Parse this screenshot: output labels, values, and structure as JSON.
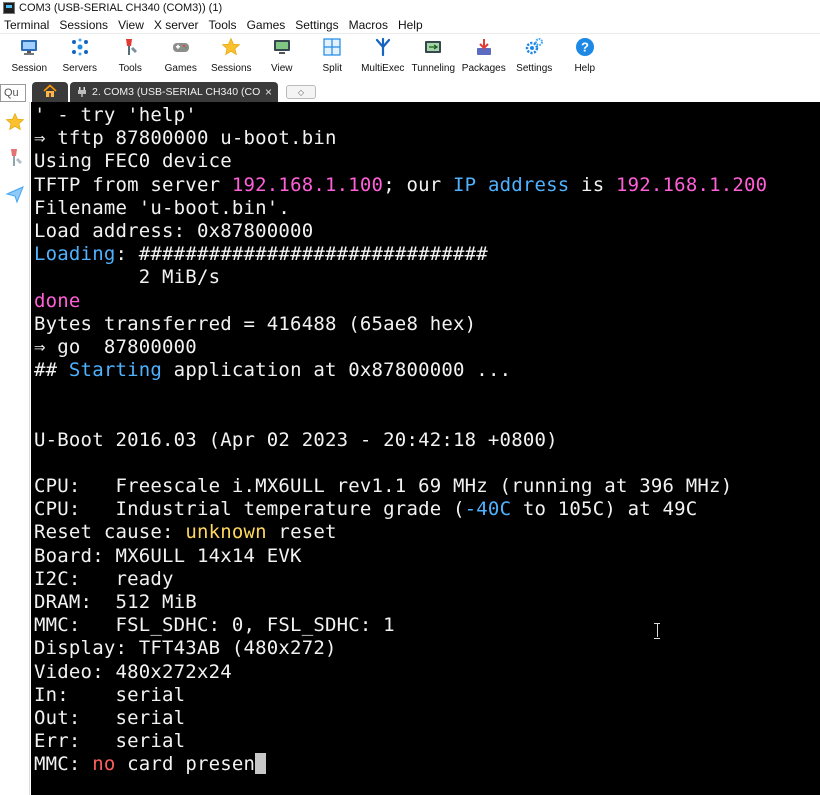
{
  "window": {
    "title": "COM3  (USB-SERIAL CH340 (COM3)) (1)"
  },
  "menu": [
    "Terminal",
    "Sessions",
    "View",
    "X server",
    "Tools",
    "Games",
    "Settings",
    "Macros",
    "Help"
  ],
  "toolbar": [
    {
      "label": "Session",
      "icon": "monitor-session-icon"
    },
    {
      "label": "Servers",
      "icon": "servers-network-icon"
    },
    {
      "label": "Tools",
      "icon": "tools-icon"
    },
    {
      "label": "Games",
      "icon": "gamepad-icon"
    },
    {
      "label": "Sessions",
      "icon": "star-icon"
    },
    {
      "label": "View",
      "icon": "view-monitor-icon"
    },
    {
      "label": "Split",
      "icon": "split-icon"
    },
    {
      "label": "MultiExec",
      "icon": "multiexec-fork-icon"
    },
    {
      "label": "Tunneling",
      "icon": "tunneling-icon"
    },
    {
      "label": "Packages",
      "icon": "packages-download-icon"
    },
    {
      "label": "Settings",
      "icon": "gears-icon"
    },
    {
      "label": "Help",
      "icon": "help-icon"
    }
  ],
  "quick_connect": {
    "value": "Qu"
  },
  "tabs": {
    "home_icon": "home-icon",
    "active": {
      "label": "2. COM3  (USB-SERIAL CH340 (CO",
      "close": "×",
      "icon": "serial-plug-icon"
    }
  },
  "sidebar": [
    {
      "icon": "star-icon"
    },
    {
      "icon": "tools-icon"
    },
    {
      "icon": "send-arrow-icon"
    }
  ],
  "colors": {
    "terminal_bg": "#000000",
    "text": "#f2f2f2",
    "magenta": "#ff5fd7",
    "blue": "#4fb2ff",
    "yellow": "#ffd75f",
    "red": "#ff5f5f"
  },
  "terminal": {
    "lines": [
      [
        {
          "t": "' - try 'help'",
          "c": "white"
        }
      ],
      [
        {
          "t": "⇒ tftp 87800000 u-boot.bin",
          "c": "white"
        }
      ],
      [
        {
          "t": "Using FEC0 device",
          "c": "white"
        }
      ],
      [
        {
          "t": "TFTP from server ",
          "c": "white"
        },
        {
          "t": "192.168.1.100",
          "c": "magenta"
        },
        {
          "t": "; our ",
          "c": "white"
        },
        {
          "t": "IP address",
          "c": "blue"
        },
        {
          "t": " is ",
          "c": "white"
        },
        {
          "t": "192.168.1.200",
          "c": "magenta"
        }
      ],
      [
        {
          "t": "Filename 'u-boot.bin'.",
          "c": "white"
        }
      ],
      [
        {
          "t": "Load address: 0x87800000",
          "c": "white"
        }
      ],
      [
        {
          "t": "Loading",
          "c": "blue"
        },
        {
          "t": ": ##############################",
          "c": "white"
        }
      ],
      [
        {
          "t": "         2 MiB/s",
          "c": "white"
        }
      ],
      [
        {
          "t": "done",
          "c": "magenta"
        }
      ],
      [
        {
          "t": "Bytes transferred = 416488 (65ae8 hex)",
          "c": "white"
        }
      ],
      [
        {
          "t": "⇒ go  87800000",
          "c": "white"
        }
      ],
      [
        {
          "t": "## ",
          "c": "white"
        },
        {
          "t": "Starting",
          "c": "blue"
        },
        {
          "t": " application at 0x87800000 ...",
          "c": "white"
        }
      ],
      [
        {
          "t": "",
          "c": "white"
        }
      ],
      [
        {
          "t": "",
          "c": "white"
        }
      ],
      [
        {
          "t": "U-Boot 2016.03 (Apr 02 2023 - 20:42:18 +0800)",
          "c": "white"
        }
      ],
      [
        {
          "t": "",
          "c": "white"
        }
      ],
      [
        {
          "t": "CPU:   Freescale i.MX6ULL rev1.1 69 MHz (running at 396 MHz)",
          "c": "white"
        }
      ],
      [
        {
          "t": "CPU:   Industrial temperature grade (",
          "c": "white"
        },
        {
          "t": "-40C",
          "c": "blue"
        },
        {
          "t": " to 105C) at 49C",
          "c": "white"
        }
      ],
      [
        {
          "t": "Reset cause: ",
          "c": "white"
        },
        {
          "t": "unknown",
          "c": "yellow"
        },
        {
          "t": " reset",
          "c": "white"
        }
      ],
      [
        {
          "t": "Board: MX6ULL 14x14 EVK",
          "c": "white"
        }
      ],
      [
        {
          "t": "I2C:   ready",
          "c": "white"
        }
      ],
      [
        {
          "t": "DRAM:  512 MiB",
          "c": "white"
        }
      ],
      [
        {
          "t": "MMC:   FSL_SDHC: 0, FSL_SDHC: 1",
          "c": "white"
        }
      ],
      [
        {
          "t": "Display: TFT43AB (480x272)",
          "c": "white"
        }
      ],
      [
        {
          "t": "Video: 480x272x24",
          "c": "white"
        }
      ],
      [
        {
          "t": "In:    serial",
          "c": "white"
        }
      ],
      [
        {
          "t": "Out:   serial",
          "c": "white"
        }
      ],
      [
        {
          "t": "Err:   serial",
          "c": "white"
        }
      ],
      [
        {
          "t": "MMC: ",
          "c": "white"
        },
        {
          "t": "no",
          "c": "red"
        },
        {
          "t": " card presen",
          "c": "white"
        }
      ]
    ]
  }
}
